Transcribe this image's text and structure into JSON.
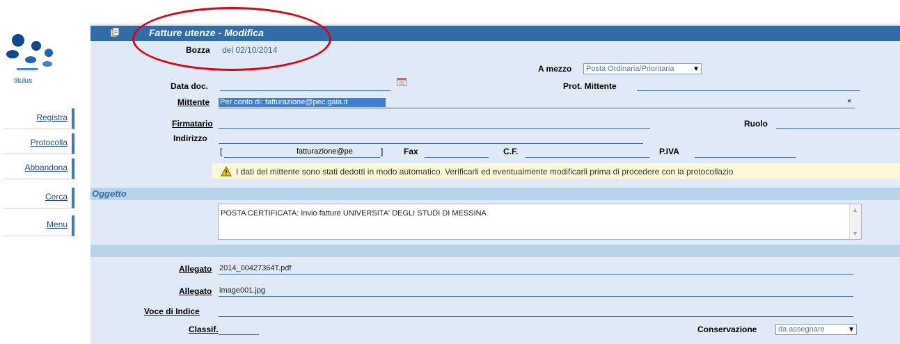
{
  "sidebar": {
    "logo_text": "titulus",
    "items": [
      {
        "label": "Registra"
      },
      {
        "label": "Protocolla"
      },
      {
        "label": "Abbandona"
      },
      {
        "label": "Cerca"
      },
      {
        "label": "Menu"
      }
    ]
  },
  "header": {
    "title": "Fatture utenze - Modifica",
    "status": "Bozza",
    "date_text": "del 02/10/2014"
  },
  "form": {
    "a_mezzo_label": "A mezzo",
    "a_mezzo_value": "Posta Ordinaria/Prioritaria",
    "data_doc_label": "Data doc.",
    "prot_mittente_label": "Prot. Mittente",
    "mittente_label": "Mittente",
    "mittente_value": "Per conto di: fatturazione@pec.gaia.it",
    "mittente_clear": "×",
    "firmatario_label": "Firmatario",
    "ruolo_label": "Ruolo",
    "indirizzo_label": "Indirizzo",
    "bracket_open": "[",
    "bracket_close": "]",
    "email_value": "fatturazione@pe",
    "fax_label": "Fax",
    "cf_label": "C.F.",
    "piva_label": "P.IVA",
    "warning_text": "I dati del mittente sono stati dedotti in modo automatico. Verificarli ed eventualmente modificarli prima di procedere con la protocollazio",
    "oggetto_label": "Oggetto",
    "oggetto_value": "POSTA CERTIFICATA: Invio fatture UNIVERSITA' DEGLI STUDI DI MESSINA",
    "allegato_label": "Allegato",
    "allegato_1": "2014_00427364T.pdf",
    "allegato_2": "image001.jpg",
    "voce_indice_label": "Voce di Indice",
    "classif_label": "Classif.",
    "conservazione_label": "Conservazione",
    "conservazione_value": "da assegnare"
  },
  "colors": {
    "titlebar": "#2f6ca8",
    "panel": "#dfeaf6",
    "band": "#b9d3ea",
    "highlight": "#3b7fd6",
    "annotation_oval": "#e3000f"
  }
}
